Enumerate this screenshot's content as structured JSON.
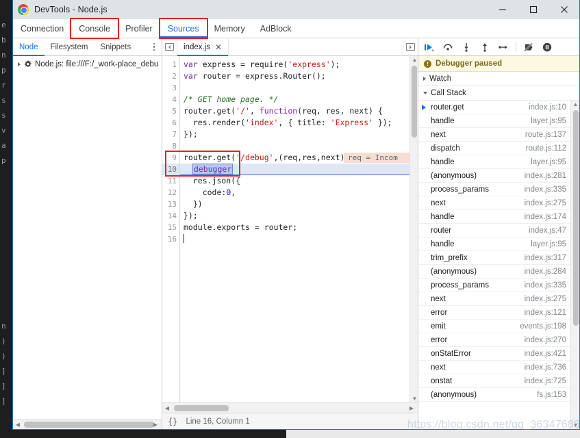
{
  "window": {
    "title": "DevTools - Node.js",
    "logo_icon": "chrome-logo-icon",
    "controls": {
      "minimize": "—",
      "maximize": "☐",
      "close": "✕"
    }
  },
  "primary_tabs": [
    {
      "label": "Connection",
      "active": false
    },
    {
      "label": "Console",
      "active": false,
      "annotated": true
    },
    {
      "label": "Profiler",
      "active": false
    },
    {
      "label": "Sources",
      "active": true,
      "annotated": true
    },
    {
      "label": "Memory",
      "active": false
    },
    {
      "label": "AdBlock",
      "active": false
    }
  ],
  "navigator": {
    "tabs": [
      {
        "label": "Node",
        "active": true
      },
      {
        "label": "Filesystem",
        "active": false
      },
      {
        "label": "Snippets",
        "active": false
      }
    ],
    "more_icon": "kebab-menu-icon",
    "tree": {
      "expand_icon": "triangle-right-icon",
      "node_icon": "gear-icon",
      "label": "Node.js: file:///F:/_work-place_debu"
    }
  },
  "editor": {
    "panel_left_icon": "collapse-left-icon",
    "panel_right_icon": "expand-right-icon",
    "tab": {
      "label": "index.js",
      "close_icon": "close-icon"
    },
    "inline_hint": "req = Incom",
    "lines": [
      {
        "n": 1,
        "tokens": [
          {
            "t": "var",
            "c": "kw"
          },
          {
            "t": " express = ",
            "c": "pl"
          },
          {
            "t": "require",
            "c": "pl"
          },
          {
            "t": "(",
            "c": "pl"
          },
          {
            "t": "'express'",
            "c": "str"
          },
          {
            "t": ");",
            "c": "pl"
          }
        ]
      },
      {
        "n": 2,
        "tokens": [
          {
            "t": "var",
            "c": "kw"
          },
          {
            "t": " router = express.Router();",
            "c": "pl"
          }
        ]
      },
      {
        "n": 3,
        "tokens": []
      },
      {
        "n": 4,
        "tokens": [
          {
            "t": "/* GET home page. */",
            "c": "com"
          }
        ]
      },
      {
        "n": 5,
        "tokens": [
          {
            "t": "router.get(",
            "c": "pl"
          },
          {
            "t": "'/'",
            "c": "str"
          },
          {
            "t": ", ",
            "c": "pl"
          },
          {
            "t": "function",
            "c": "kw"
          },
          {
            "t": "(req, res, next) {",
            "c": "pl"
          }
        ]
      },
      {
        "n": 6,
        "tokens": [
          {
            "t": "  res.render(",
            "c": "pl"
          },
          {
            "t": "'index'",
            "c": "str"
          },
          {
            "t": ", { title: ",
            "c": "pl"
          },
          {
            "t": "'Express'",
            "c": "str"
          },
          {
            "t": " });",
            "c": "pl"
          }
        ]
      },
      {
        "n": 7,
        "tokens": [
          {
            "t": "});",
            "c": "pl"
          }
        ]
      },
      {
        "n": 8,
        "tokens": []
      },
      {
        "n": 9,
        "tokens": [
          {
            "t": "router.get(",
            "c": "pl"
          },
          {
            "t": "'/debug'",
            "c": "str"
          },
          {
            "t": ",(req,res,next)=>{",
            "c": "pl"
          }
        ]
      },
      {
        "n": 10,
        "tokens": [
          {
            "t": "  ",
            "c": "pl"
          },
          {
            "t": "debugger",
            "c": "kw sel-token"
          }
        ],
        "paused": true
      },
      {
        "n": 11,
        "tokens": [
          {
            "t": "  res.json({",
            "c": "pl"
          }
        ]
      },
      {
        "n": 12,
        "tokens": [
          {
            "t": "    code:",
            "c": "pl"
          },
          {
            "t": "0",
            "c": "num"
          },
          {
            "t": ",",
            "c": "pl"
          }
        ]
      },
      {
        "n": 13,
        "tokens": [
          {
            "t": "  })",
            "c": "pl"
          }
        ]
      },
      {
        "n": 14,
        "tokens": [
          {
            "t": "});",
            "c": "pl"
          }
        ]
      },
      {
        "n": 15,
        "tokens": [
          {
            "t": "module.exports = router;",
            "c": "pl"
          }
        ]
      },
      {
        "n": 16,
        "tokens": []
      }
    ]
  },
  "statusbar": {
    "pretty_print_icon": "{}",
    "position": "Line 16, Column 1"
  },
  "debug_toolbar": [
    {
      "icon": "resume-script-icon",
      "active": true
    },
    {
      "icon": "step-over-icon",
      "active": false
    },
    {
      "icon": "step-into-icon",
      "active": false
    },
    {
      "icon": "step-out-icon",
      "active": false
    },
    {
      "icon": "step-icon",
      "active": false
    },
    {
      "icon": "deactivate-breakpoints-icon",
      "active": false
    },
    {
      "icon": "pause-on-exceptions-icon",
      "active": false
    }
  ],
  "debugger_panel": {
    "banner": {
      "icon": "warning-icon",
      "text": "Debugger paused"
    },
    "watch": {
      "label": "Watch",
      "expanded": false
    },
    "call_stack": {
      "label": "Call Stack",
      "expanded": true
    },
    "frames": [
      {
        "name": "router.get",
        "location": "index.js:10",
        "current": true
      },
      {
        "name": "handle",
        "location": "layer.js:95",
        "current": false
      },
      {
        "name": "next",
        "location": "route.js:137",
        "current": false
      },
      {
        "name": "dispatch",
        "location": "route.js:112",
        "current": false
      },
      {
        "name": "handle",
        "location": "layer.js:95",
        "current": false
      },
      {
        "name": "(anonymous)",
        "location": "index.js:281",
        "current": false
      },
      {
        "name": "process_params",
        "location": "index.js:335",
        "current": false
      },
      {
        "name": "next",
        "location": "index.js:275",
        "current": false
      },
      {
        "name": "handle",
        "location": "index.js:174",
        "current": false
      },
      {
        "name": "router",
        "location": "index.js:47",
        "current": false
      },
      {
        "name": "handle",
        "location": "layer.js:95",
        "current": false
      },
      {
        "name": "trim_prefix",
        "location": "index.js:317",
        "current": false
      },
      {
        "name": "(anonymous)",
        "location": "index.js:284",
        "current": false
      },
      {
        "name": "process_params",
        "location": "index.js:335",
        "current": false
      },
      {
        "name": "next",
        "location": "index.js:275",
        "current": false
      },
      {
        "name": "error",
        "location": "index.js:121",
        "current": false
      },
      {
        "name": "emit",
        "location": "events.js:198",
        "current": false
      },
      {
        "name": "error",
        "location": "index.js:270",
        "current": false
      },
      {
        "name": "onStatError",
        "location": "index.js:421",
        "current": false
      },
      {
        "name": "next",
        "location": "index.js:736",
        "current": false
      },
      {
        "name": "onstat",
        "location": "index.js:725",
        "current": false
      },
      {
        "name": "(anonymous)",
        "location": "fs.js:153",
        "current": false
      }
    ]
  },
  "watermark": "https://blog.csdn.net/qq_36347686",
  "background_editor_lines": [
    "e",
    "b",
    "n",
    "p",
    "r",
    "s",
    "s",
    "v",
    "a",
    "p",
    "",
    "",
    "",
    "",
    "",
    "",
    "",
    "",
    "",
    "",
    "n",
    ")",
    ")",
    "]",
    "]",
    "]"
  ],
  "colors": {
    "accent": "#1a73e8",
    "annotation": "#ee1c1c",
    "paused_bg": "#fdf8e2",
    "paused_text": "#7a6a1f",
    "exec_line": "#dfe6f7",
    "string": "#c41a16",
    "keyword": "#7c28a5",
    "comment": "#236e25",
    "number": "#1c00cf",
    "hint_bg": "#f6ded2"
  }
}
